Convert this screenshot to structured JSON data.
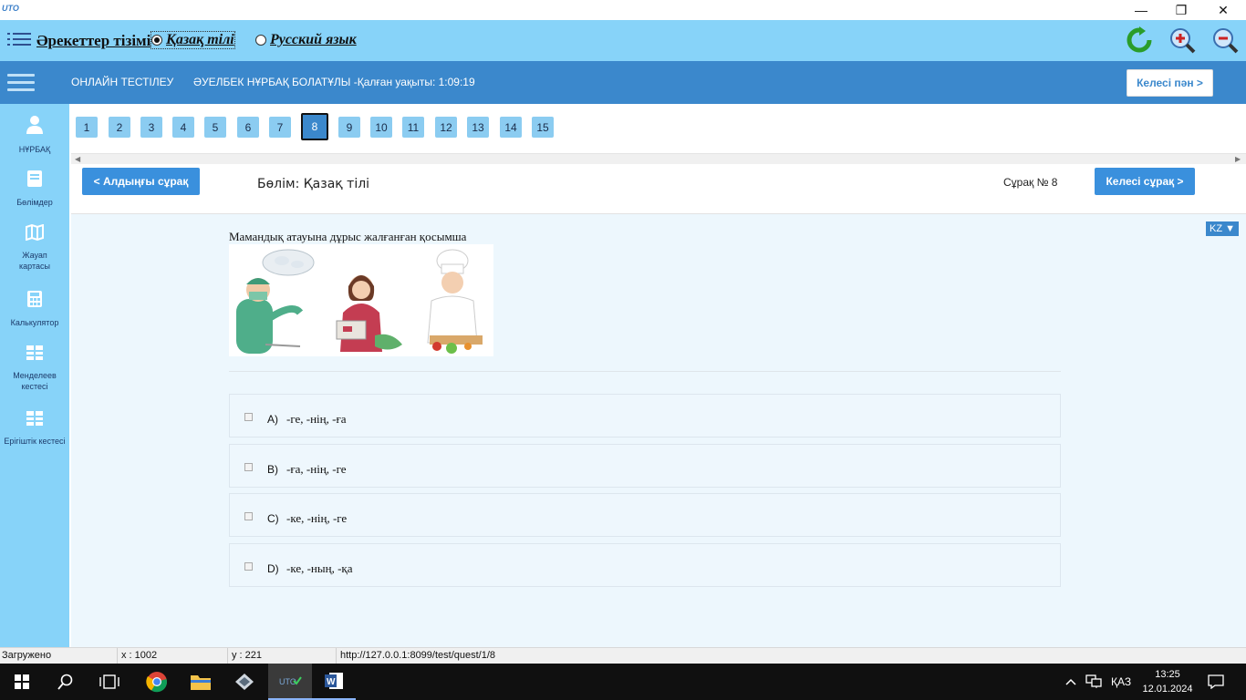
{
  "titlebar": {
    "app_logo": "UTO",
    "minimize": "—",
    "restore": "❐",
    "close": "✕"
  },
  "toolbar": {
    "actions_label": "Әрекеттер тізімі",
    "languages": [
      {
        "label": "Қазақ тілі",
        "selected": true
      },
      {
        "label": "Русский язык",
        "selected": false
      }
    ]
  },
  "header": {
    "title": "ОНЛАЙН ТЕСТІЛЕУ",
    "user_time": "ӘУЕЛБЕК НҰРБАҚ БОЛАТҰЛЫ -Қалған уақыты: 1:09:19",
    "next_subject": "Келесі пән >"
  },
  "sidebar": {
    "items": [
      {
        "label": "НҰРБАҚ",
        "icon": "user-icon"
      },
      {
        "label": "Бөлімдер",
        "icon": "book-icon"
      },
      {
        "label": "Жауап картасы",
        "icon": "map-icon"
      },
      {
        "label": "Калькулятор",
        "icon": "calculator-icon"
      },
      {
        "label": "Менделеев кестесі",
        "icon": "table-icon"
      },
      {
        "label": "Ерігіштік кестесі",
        "icon": "table-icon"
      }
    ]
  },
  "question_numbers": [
    "1",
    "2",
    "3",
    "4",
    "5",
    "6",
    "7",
    "8",
    "9",
    "10",
    "11",
    "12",
    "13",
    "14",
    "15"
  ],
  "active_question": "8",
  "question_header": {
    "prev_label": "< Алдыңғы сұрақ",
    "section": "Бөлім: Қазақ тілі",
    "question_no": "Сұрақ № 8",
    "next_label": "Келесі сұрақ >"
  },
  "question": {
    "lang_badge": "KZ ▼",
    "text": "Мамандық атауына дұрыс жалғанған қосымша",
    "answers": [
      {
        "letter": "A)",
        "text": "-ге, -нің, -ға"
      },
      {
        "letter": "B)",
        "text": "-ға, -нің, -ге"
      },
      {
        "letter": "C)",
        "text": "-ке, -нің, -ге"
      },
      {
        "letter": "D)",
        "text": "-ке, -ның, -қа"
      }
    ]
  },
  "statusbar": {
    "status": "Загружено",
    "x": "x : 1002",
    "y": "y : 221",
    "url": "http://127.0.0.1:8099/test/quest/1/8"
  },
  "taskbar": {
    "lang": "ҚАЗ",
    "time": "13:25",
    "date": "12.01.2024"
  },
  "colors": {
    "toolbar_bg": "#87d3f9",
    "header_bg": "#3b88cc",
    "button_blue": "#3a90dd",
    "content_bg": "#edf7fd"
  }
}
